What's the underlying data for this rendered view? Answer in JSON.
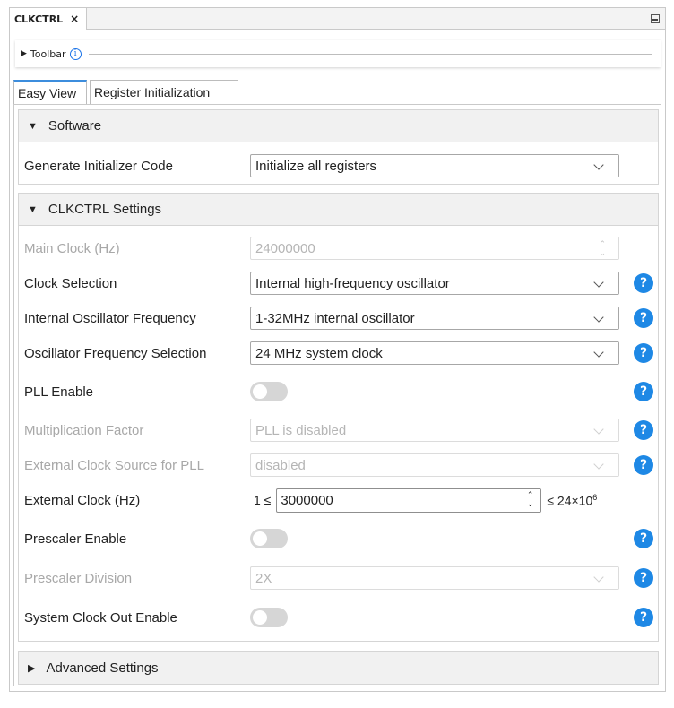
{
  "document_tab": {
    "title": "CLKCTRL",
    "close": "×"
  },
  "toolbar": {
    "label": "Toolbar",
    "info": "i"
  },
  "view_tabs": [
    {
      "label": "Easy View",
      "active": true
    },
    {
      "label": "Register Initialization",
      "active": false
    }
  ],
  "software": {
    "header": "Software",
    "generate_initializer_code": {
      "label": "Generate Initializer Code",
      "value": "Initialize all registers"
    }
  },
  "clkctrl": {
    "header": "CLKCTRL Settings",
    "main_clock": {
      "label": "Main Clock (Hz)",
      "value": "24000000",
      "disabled": true
    },
    "clock_selection": {
      "label": "Clock Selection",
      "value": "Internal high-frequency oscillator"
    },
    "internal_osc_freq": {
      "label": "Internal Oscillator Frequency",
      "value": "1-32MHz internal oscillator"
    },
    "osc_freq_selection": {
      "label": "Oscillator Frequency Selection",
      "value": "24 MHz system clock"
    },
    "pll_enable": {
      "label": "PLL Enable",
      "on": false
    },
    "multiplication_factor": {
      "label": "Multiplication Factor",
      "value": "PLL is disabled",
      "disabled": true
    },
    "ext_clock_source_pll": {
      "label": "External Clock Source for PLL",
      "value": "disabled",
      "disabled": true
    },
    "external_clock": {
      "label": "External Clock (Hz)",
      "min": "1 ≤",
      "value": "3000000",
      "max_prefix": "≤ 24×10",
      "max_exp": "6"
    },
    "prescaler_enable": {
      "label": "Prescaler Enable",
      "on": false
    },
    "prescaler_division": {
      "label": "Prescaler Division",
      "value": "2X",
      "disabled": true
    },
    "sysclk_out_enable": {
      "label": "System Clock Out Enable",
      "on": false
    }
  },
  "advanced": {
    "header": "Advanced Settings"
  },
  "help_glyph": "?",
  "colors": {
    "accent": "#1e88e5",
    "tab_active_border": "#3c8ddd",
    "disabled_text": "#a8a8a8"
  }
}
